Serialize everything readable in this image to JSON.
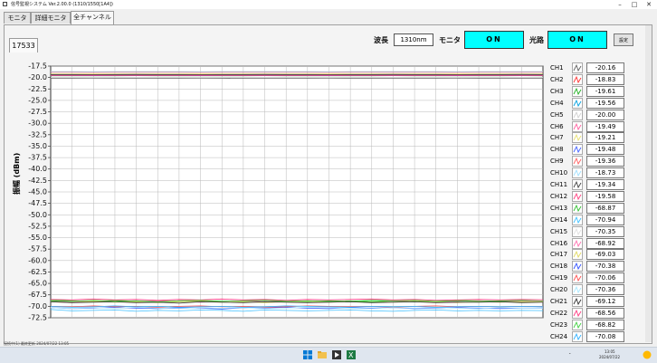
{
  "window": {
    "title": "信号監視システム Ver.2.00.0 (1310/1550[1A4])"
  },
  "tabs": [
    {
      "label": "モニタ",
      "active": false
    },
    {
      "label": "詳細モニタ",
      "active": false
    },
    {
      "label": "全チャンネル",
      "active": true
    }
  ],
  "panel_id": "17533",
  "controls": {
    "wavelength_label": "波長",
    "wavelength_value": "1310nm",
    "monitor_label": "モニタ",
    "monitor_state": "ON",
    "path_label": "光路",
    "path_state": "ON",
    "settings_label": "設定"
  },
  "colors": {
    "on_bg": "#00ffff"
  },
  "chart_data": {
    "type": "line",
    "ylabel": "振幅 (dBm)",
    "ylim": [
      -72.5,
      -17.5
    ],
    "yticks": [
      "-17.5",
      "-20.0",
      "-22.5",
      "-25.0",
      "-27.5",
      "-30.0",
      "-32.5",
      "-35.0",
      "-37.5",
      "-40.0",
      "-42.5",
      "-45.0",
      "-47.5",
      "-50.0",
      "-52.5",
      "-55.0",
      "-57.5",
      "-60.0",
      "-62.5",
      "-65.0",
      "-67.5",
      "-70.0",
      "-72.5"
    ],
    "x_points": 24,
    "grid": true,
    "legend_placement": "right",
    "series": [
      {
        "name": "CH1",
        "color": "#606060",
        "values": [
          -20.16,
          -20.16,
          -20.15,
          -20.17,
          -20.16,
          -20.16,
          -20.15,
          -20.16,
          -20.17,
          -20.16,
          -20.16,
          -20.15,
          -20.16,
          -20.16,
          -20.17,
          -20.16,
          -20.16,
          -20.15,
          -20.16,
          -20.16,
          -20.17,
          -20.16,
          -20.16,
          -20.16
        ]
      },
      {
        "name": "CH2",
        "color": "#ff3030",
        "values": [
          -18.83,
          -18.83,
          -18.84,
          -18.83,
          -18.82,
          -18.83,
          -18.83,
          -18.84,
          -18.83,
          -18.83,
          -18.82,
          -18.83,
          -18.83,
          -18.84,
          -18.83,
          -18.83,
          -18.82,
          -18.83,
          -18.83,
          -18.84,
          -18.83,
          -18.83,
          -18.82,
          -18.83
        ]
      },
      {
        "name": "CH3",
        "color": "#20b020",
        "values": [
          -19.61,
          -19.61,
          -19.62,
          -19.61,
          -19.6,
          -19.61,
          -19.61,
          -19.62,
          -19.61,
          -19.61,
          -19.6,
          -19.61,
          -19.61,
          -19.62,
          -19.61,
          -19.61,
          -19.6,
          -19.61,
          -19.61,
          -19.62,
          -19.61,
          -19.61,
          -19.6,
          -19.61
        ]
      },
      {
        "name": "CH4",
        "color": "#00a0e0",
        "values": [
          -19.56,
          -19.56,
          -19.57,
          -19.56,
          -19.55,
          -19.56,
          -19.56,
          -19.57,
          -19.56,
          -19.56,
          -19.55,
          -19.56,
          -19.56,
          -19.57,
          -19.56,
          -19.56,
          -19.55,
          -19.56,
          -19.56,
          -19.57,
          -19.56,
          -19.56,
          -19.55,
          -19.56
        ]
      },
      {
        "name": "CH5",
        "color": "#d0d0d0",
        "values": [
          -20.0,
          -20.0,
          -20.01,
          -20.0,
          -19.99,
          -20.0,
          -20.0,
          -20.01,
          -20.0,
          -20.0,
          -19.99,
          -20.0,
          -20.0,
          -20.01,
          -20.0,
          -20.0,
          -19.99,
          -20.0,
          -20.0,
          -20.01,
          -20.0,
          -20.0,
          -19.99,
          -20.0
        ]
      },
      {
        "name": "CH6",
        "color": "#ff60a0",
        "values": [
          -19.49,
          -19.49,
          -19.5,
          -19.49,
          -19.48,
          -19.49,
          -19.49,
          -19.5,
          -19.49,
          -19.49,
          -19.48,
          -19.49,
          -19.49,
          -19.5,
          -19.49,
          -19.49,
          -19.48,
          -19.49,
          -19.49,
          -19.5,
          -19.49,
          -19.49,
          -19.48,
          -19.49
        ]
      },
      {
        "name": "CH7",
        "color": "#e8e070",
        "values": [
          -19.21,
          -19.21,
          -19.22,
          -19.21,
          -19.2,
          -19.21,
          -19.21,
          -19.22,
          -19.21,
          -19.21,
          -19.2,
          -19.21,
          -19.21,
          -19.22,
          -19.21,
          -19.21,
          -19.2,
          -19.21,
          -19.21,
          -19.22,
          -19.21,
          -19.21,
          -19.2,
          -19.21
        ]
      },
      {
        "name": "CH8",
        "color": "#4060ff",
        "values": [
          -19.48,
          -19.48,
          -19.49,
          -19.48,
          -19.47,
          -19.48,
          -19.48,
          -19.49,
          -19.48,
          -19.48,
          -19.47,
          -19.48,
          -19.48,
          -19.49,
          -19.48,
          -19.48,
          -19.47,
          -19.48,
          -19.48,
          -19.49,
          -19.48,
          -19.48,
          -19.47,
          -19.48
        ]
      },
      {
        "name": "CH9",
        "color": "#ff6060",
        "values": [
          -19.36,
          -19.36,
          -19.37,
          -19.36,
          -19.35,
          -19.36,
          -19.36,
          -19.37,
          -19.36,
          -19.36,
          -19.35,
          -19.36,
          -19.36,
          -19.37,
          -19.36,
          -19.36,
          -19.35,
          -19.36,
          -19.36,
          -19.37,
          -19.36,
          -19.36,
          -19.35,
          -19.36
        ]
      },
      {
        "name": "CH10",
        "color": "#a0e0ff",
        "values": [
          -18.73,
          -18.73,
          -18.74,
          -18.73,
          -18.72,
          -18.73,
          -18.73,
          -18.74,
          -18.73,
          -18.73,
          -18.72,
          -18.73,
          -18.73,
          -18.74,
          -18.73,
          -18.73,
          -18.72,
          -18.73,
          -18.73,
          -18.74,
          -18.73,
          -18.73,
          -18.72,
          -18.73
        ]
      },
      {
        "name": "CH11",
        "color": "#404040",
        "values": [
          -19.34,
          -19.34,
          -19.35,
          -19.34,
          -19.33,
          -19.34,
          -19.34,
          -19.35,
          -19.34,
          -19.34,
          -19.33,
          -19.34,
          -19.34,
          -19.35,
          -19.34,
          -19.34,
          -19.33,
          -19.34,
          -19.34,
          -19.35,
          -19.34,
          -19.34,
          -19.33,
          -19.34
        ]
      },
      {
        "name": "CH12",
        "color": "#ff4080",
        "values": [
          -19.58,
          -19.58,
          -19.59,
          -19.58,
          -19.57,
          -19.58,
          -19.58,
          -19.59,
          -19.58,
          -19.58,
          -19.57,
          -19.58,
          -19.58,
          -19.59,
          -19.58,
          -19.58,
          -19.57,
          -19.58,
          -19.58,
          -19.59,
          -19.58,
          -19.58,
          -19.57,
          -19.58
        ]
      },
      {
        "name": "CH13",
        "color": "#30c030",
        "values": [
          -68.6,
          -68.8,
          -68.9,
          -68.7,
          -68.9,
          -69.0,
          -68.8,
          -68.7,
          -68.9,
          -68.8,
          -68.6,
          -68.9,
          -69.0,
          -68.8,
          -68.9,
          -68.7,
          -68.8,
          -69.0,
          -68.9,
          -68.7,
          -68.8,
          -68.9,
          -68.8,
          -68.87
        ]
      },
      {
        "name": "CH14",
        "color": "#40c0ff",
        "values": [
          -70.7,
          -71.0,
          -70.9,
          -70.8,
          -71.1,
          -70.9,
          -71.0,
          -70.8,
          -70.9,
          -71.1,
          -70.8,
          -70.9,
          -71.0,
          -70.9,
          -70.8,
          -71.0,
          -71.1,
          -70.9,
          -70.8,
          -71.0,
          -70.9,
          -71.0,
          -70.9,
          -70.94
        ]
      },
      {
        "name": "CH15",
        "color": "#e0e0e0",
        "values": [
          -70.2,
          -70.4,
          -70.3,
          -70.5,
          -70.3,
          -70.2,
          -70.4,
          -70.3,
          -70.5,
          -70.4,
          -70.2,
          -70.3,
          -70.4,
          -70.3,
          -70.5,
          -70.3,
          -70.2,
          -70.4,
          -70.3,
          -70.4,
          -70.3,
          -70.4,
          -70.3,
          -70.35
        ]
      },
      {
        "name": "CH16",
        "color": "#ff70b0",
        "values": [
          -68.9,
          -69.1,
          -68.8,
          -68.9,
          -69.0,
          -68.8,
          -68.9,
          -69.1,
          -68.9,
          -68.8,
          -69.0,
          -68.9,
          -68.8,
          -69.0,
          -68.9,
          -69.1,
          -68.8,
          -68.9,
          -69.0,
          -68.9,
          -68.8,
          -69.0,
          -68.9,
          -68.92
        ]
      },
      {
        "name": "CH17",
        "color": "#e0d860",
        "values": [
          -69.0,
          -69.2,
          -68.9,
          -69.1,
          -69.0,
          -69.2,
          -69.0,
          -68.9,
          -69.1,
          -69.0,
          -69.2,
          -69.0,
          -68.9,
          -69.1,
          -69.0,
          -69.0,
          -69.1,
          -68.9,
          -69.0,
          -69.2,
          -69.0,
          -69.1,
          -69.0,
          -69.03
        ]
      },
      {
        "name": "CH18",
        "color": "#3050ff",
        "values": [
          -70.3,
          -70.5,
          -70.4,
          -70.2,
          -70.4,
          -70.5,
          -70.3,
          -70.4,
          -70.6,
          -70.3,
          -70.4,
          -70.2,
          -70.4,
          -70.5,
          -70.3,
          -70.4,
          -70.3,
          -70.5,
          -70.4,
          -70.3,
          -70.4,
          -70.5,
          -70.4,
          -70.38
        ]
      },
      {
        "name": "CH19",
        "color": "#ff5050",
        "values": [
          -70.0,
          -70.1,
          -69.9,
          -70.1,
          -70.0,
          -70.2,
          -70.0,
          -69.9,
          -70.1,
          -70.0,
          -70.2,
          -70.1,
          -69.9,
          -70.0,
          -70.1,
          -70.0,
          -70.2,
          -70.0,
          -69.9,
          -70.1,
          -70.0,
          -70.1,
          -70.0,
          -70.06
        ]
      },
      {
        "name": "CH20",
        "color": "#a8e8ff",
        "values": [
          -70.3,
          -70.5,
          -70.3,
          -70.4,
          -70.2,
          -70.4,
          -70.5,
          -70.3,
          -70.4,
          -70.3,
          -70.5,
          -70.4,
          -70.2,
          -70.3,
          -70.4,
          -70.5,
          -70.3,
          -70.4,
          -70.3,
          -70.4,
          -70.5,
          -70.3,
          -70.4,
          -70.36
        ]
      },
      {
        "name": "CH21",
        "color": "#303030",
        "values": [
          -69.0,
          -69.2,
          -69.1,
          -69.0,
          -69.2,
          -69.1,
          -69.3,
          -69.0,
          -69.1,
          -69.2,
          -69.0,
          -69.1,
          -69.2,
          -69.1,
          -69.0,
          -69.2,
          -69.1,
          -69.0,
          -69.2,
          -69.1,
          -69.1,
          -69.0,
          -69.2,
          -69.12
        ]
      },
      {
        "name": "CH22",
        "color": "#ff3a80",
        "values": [
          -68.5,
          -68.6,
          -68.4,
          -68.6,
          -68.5,
          -68.7,
          -68.5,
          -68.6,
          -68.4,
          -68.6,
          -68.5,
          -68.7,
          -68.5,
          -68.6,
          -68.5,
          -68.4,
          -68.6,
          -68.5,
          -68.7,
          -68.6,
          -68.5,
          -68.6,
          -68.5,
          -68.56
        ]
      },
      {
        "name": "CH23",
        "color": "#40d040",
        "values": [
          -68.8,
          -68.9,
          -68.7,
          -68.9,
          -68.8,
          -69.0,
          -68.8,
          -68.7,
          -68.9,
          -68.8,
          -68.7,
          -68.9,
          -68.8,
          -68.9,
          -68.8,
          -69.0,
          -68.8,
          -68.7,
          -68.9,
          -68.8,
          -68.9,
          -68.8,
          -68.7,
          -68.82
        ]
      },
      {
        "name": "CH24",
        "color": "#30b0ff",
        "values": [
          -70.0,
          -70.2,
          -70.1,
          -69.9,
          -70.1,
          -70.0,
          -70.2,
          -70.1,
          -70.0,
          -70.2,
          -70.1,
          -69.9,
          -70.0,
          -70.1,
          -70.2,
          -70.0,
          -70.1,
          -70.0,
          -70.2,
          -70.1,
          -70.0,
          -70.1,
          -70.0,
          -70.08
        ]
      }
    ]
  },
  "channels": [
    {
      "name": "CH1",
      "value": "-20.16",
      "color": "#606060"
    },
    {
      "name": "CH2",
      "value": "-18.83",
      "color": "#ff3030"
    },
    {
      "name": "CH3",
      "value": "-19.61",
      "color": "#20b020"
    },
    {
      "name": "CH4",
      "value": "-19.56",
      "color": "#00a0e0"
    },
    {
      "name": "CH5",
      "value": "-20.00",
      "color": "#d0d0d0"
    },
    {
      "name": "CH6",
      "value": "-19.49",
      "color": "#ff60a0"
    },
    {
      "name": "CH7",
      "value": "-19.21",
      "color": "#e8e070"
    },
    {
      "name": "CH8",
      "value": "-19.48",
      "color": "#4060ff"
    },
    {
      "name": "CH9",
      "value": "-19.36",
      "color": "#ff6060"
    },
    {
      "name": "CH10",
      "value": "-18.73",
      "color": "#a0e0ff"
    },
    {
      "name": "CH11",
      "value": "-19.34",
      "color": "#404040"
    },
    {
      "name": "CH12",
      "value": "-19.58",
      "color": "#ff4080"
    },
    {
      "name": "CH13",
      "value": "-68.87",
      "color": "#30c030"
    },
    {
      "name": "CH14",
      "value": "-70.94",
      "color": "#40c0ff"
    },
    {
      "name": "CH15",
      "value": "-70.35",
      "color": "#e0e0e0"
    },
    {
      "name": "CH16",
      "value": "-68.92",
      "color": "#ff70b0"
    },
    {
      "name": "CH17",
      "value": "-69.03",
      "color": "#e0d860"
    },
    {
      "name": "CH18",
      "value": "-70.38",
      "color": "#3050ff"
    },
    {
      "name": "CH19",
      "value": "-70.06",
      "color": "#ff5050"
    },
    {
      "name": "CH20",
      "value": "-70.36",
      "color": "#a8e8ff"
    },
    {
      "name": "CH21",
      "value": "-69.12",
      "color": "#303030"
    },
    {
      "name": "CH22",
      "value": "-68.56",
      "color": "#ff3a80"
    },
    {
      "name": "CH23",
      "value": "-68.82",
      "color": "#40d040"
    },
    {
      "name": "CH24",
      "value": "-70.08",
      "color": "#30b0ff"
    }
  ],
  "statusbar": {
    "text": "接続中(1) 最終更新 2024/07/22 13:05"
  },
  "taskbar": {
    "apps": [
      "windows-start",
      "file-explorer",
      "monitor-app",
      "excel"
    ],
    "time": "13:05",
    "date": "2024/07/22"
  }
}
